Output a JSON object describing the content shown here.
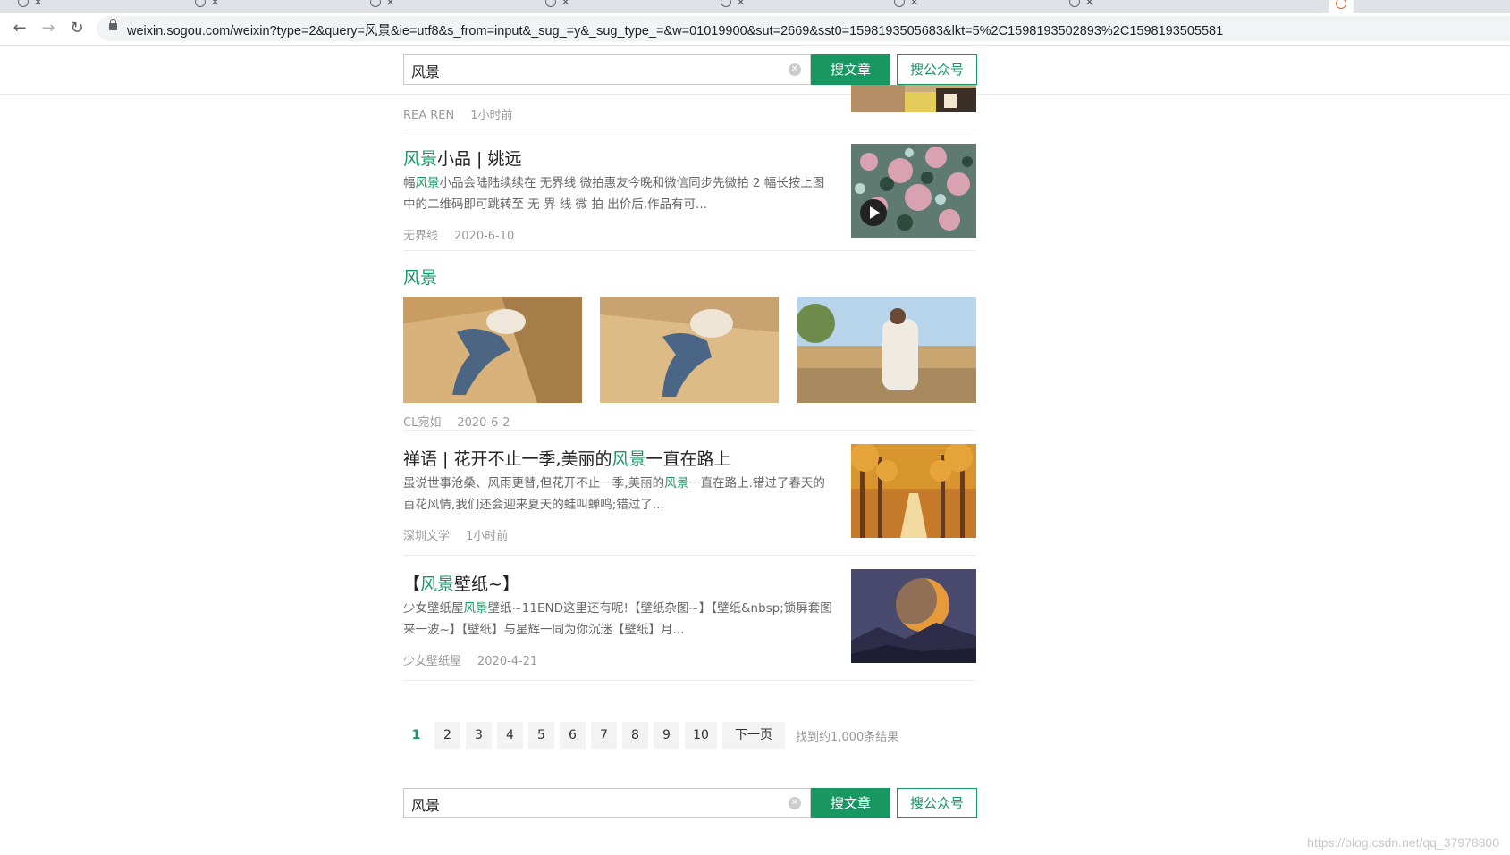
{
  "browser": {
    "url": "weixin.sogou.com/weixin?type=2&query=风景&ie=utf8&s_from=input&_sug_=y&_sug_type_=&w=01019900&sut=2669&sst0=1598193505683&lkt=5%2C1598193502893%2C1598193505581"
  },
  "search": {
    "query": "风景",
    "btn_article": "搜文章",
    "btn_account": "搜公众号"
  },
  "results": [
    {
      "source": "REA REN",
      "date": "1小时前"
    },
    {
      "title_hl": "风景",
      "title_rest": "小品 | 姚远",
      "desc_pre": "幅",
      "desc_hl": "风景",
      "desc_post": "小品会陆陆续续在 无界线 微拍惠友今晚和微信同步先微拍 2 幅长按上图中的二维码即可跳转至 无 界 线 微 拍 出价后,作品有可...",
      "source": "无界线",
      "date": "2020-6-10"
    },
    {
      "title_hl": "风景",
      "source": "CL宛如",
      "date": "2020-6-2"
    },
    {
      "title_pre": "禅语 | 花开不止一季,美丽的",
      "title_hl": "风景",
      "title_rest": "一直在路上",
      "desc_pre": "虽说世事沧桑、风雨更替,但花开不止一季,美丽的",
      "desc_hl": "风景",
      "desc_post": "一直在路上.错过了春天的百花风情,我们还会迎来夏天的蛙叫蝉鸣;错过了...",
      "source": "深圳文学",
      "date": "1小时前"
    },
    {
      "title_pre": "【",
      "title_hl": "风景",
      "title_rest": "壁纸~】",
      "desc_pre": "少女壁纸屋",
      "desc_hl": "风景",
      "desc_post": "壁纸~11END这里还有呢!【壁纸杂图~】【壁纸&nbsp;锁屏套图来一波~】【壁纸】与星辉一同为你沉迷【壁纸】月...",
      "source": "少女壁纸屋",
      "date": "2020-4-21"
    }
  ],
  "pager": {
    "pages": [
      "1",
      "2",
      "3",
      "4",
      "5",
      "6",
      "7",
      "8",
      "9",
      "10"
    ],
    "next": "下一页",
    "count": "找到约1,000条结果"
  },
  "watermark": "https://blog.csdn.net/qq_37978800"
}
